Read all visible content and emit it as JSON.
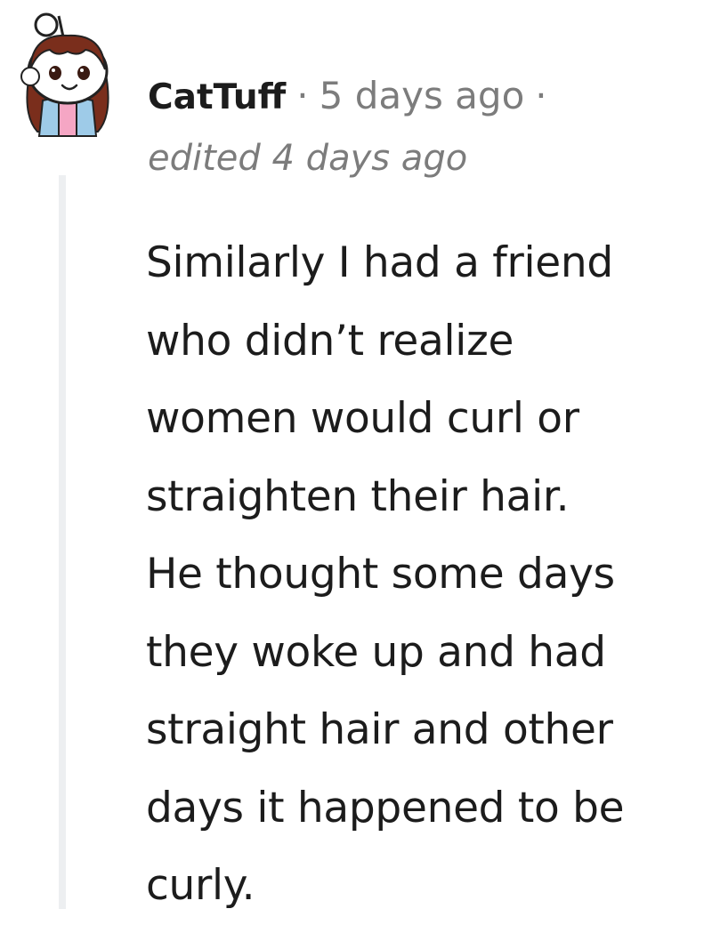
{
  "comment": {
    "author": "CatTuff",
    "separator": "·",
    "timestamp": "5 days ago",
    "edited": "edited 4 days ago",
    "body": "Similarly I had a friend\nwho didn’t realize\nwomen would curl or\nstraighten their hair.\nHe thought some days\nthey woke up and had\nstraight hair and other\ndays it happened to be\ncurly.",
    "avatar_icon": "snoo-avatar-icon"
  },
  "colors": {
    "username": "#1c1c1c",
    "meta": "#7c7c7c",
    "body": "#1c1c1c",
    "thread_line": "#edeff1"
  }
}
